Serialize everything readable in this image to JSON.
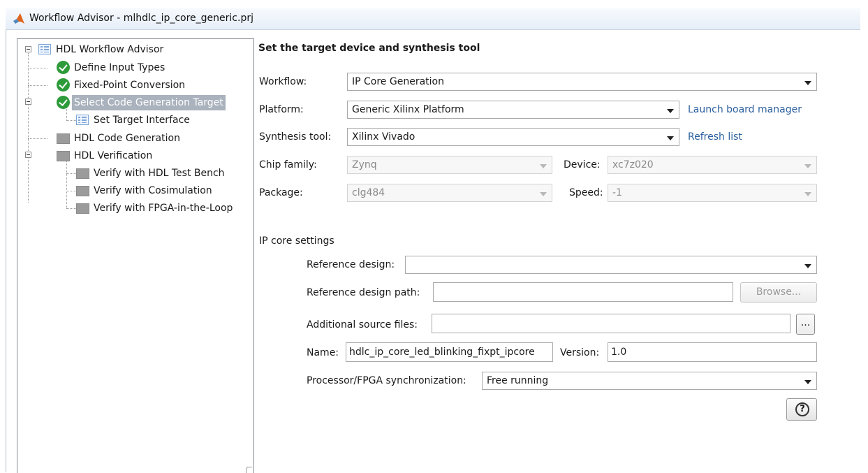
{
  "window": {
    "title": "Workflow Advisor - mlhdlc_ip_core_generic.prj"
  },
  "tree": {
    "root": "HDL Workflow Advisor",
    "items": [
      {
        "label": "Define Input Types"
      },
      {
        "label": "Fixed-Point Conversion"
      },
      {
        "label": "Select Code Generation Target"
      },
      {
        "label": "Set Target Interface"
      },
      {
        "label": "HDL Code Generation"
      },
      {
        "label": "HDL Verification"
      },
      {
        "label": "Verify with HDL Test Bench"
      },
      {
        "label": "Verify with Cosimulation"
      },
      {
        "label": "Verify with FPGA-in-the-Loop"
      }
    ]
  },
  "panel": {
    "title": "Set the target device and synthesis tool",
    "workflow": {
      "label": "Workflow:",
      "value": "IP Core Generation"
    },
    "platform": {
      "label": "Platform:",
      "value": "Generic Xilinx Platform",
      "link": "Launch board manager"
    },
    "synthesis": {
      "label": "Synthesis tool:",
      "value": "Xilinx Vivado",
      "link": "Refresh list"
    },
    "chip_family": {
      "label": "Chip family:",
      "value": "Zynq"
    },
    "device": {
      "label": "Device:",
      "value": "xc7z020"
    },
    "package": {
      "label": "Package:",
      "value": "clg484"
    },
    "speed": {
      "label": "Speed:",
      "value": "-1"
    },
    "ip_core": {
      "section": "IP core settings",
      "ref_design": {
        "label": "Reference design:",
        "value": ""
      },
      "ref_path": {
        "label": "Reference design path:",
        "value": "",
        "browse": "Browse..."
      },
      "sources": {
        "label": "Additional source files:",
        "value": "",
        "more": "..."
      },
      "name": {
        "label": "Name:",
        "value": "hdlc_ip_core_led_blinking_fixpt_ipcore"
      },
      "version": {
        "label": "Version:",
        "value": "1.0"
      },
      "sync": {
        "label": "Processor/FPGA synchronization:",
        "value": "Free running"
      }
    },
    "help": "?"
  },
  "colors": {
    "accent_link": "#2a5f9e",
    "check_green": "#2e9b3a",
    "selection": "#aab2bd"
  },
  "icons": {
    "logo": "matlab-logo-icon",
    "ok": "check-circle-icon",
    "task": "gray-square-icon",
    "list": "list-icon",
    "help": "help-icon"
  }
}
